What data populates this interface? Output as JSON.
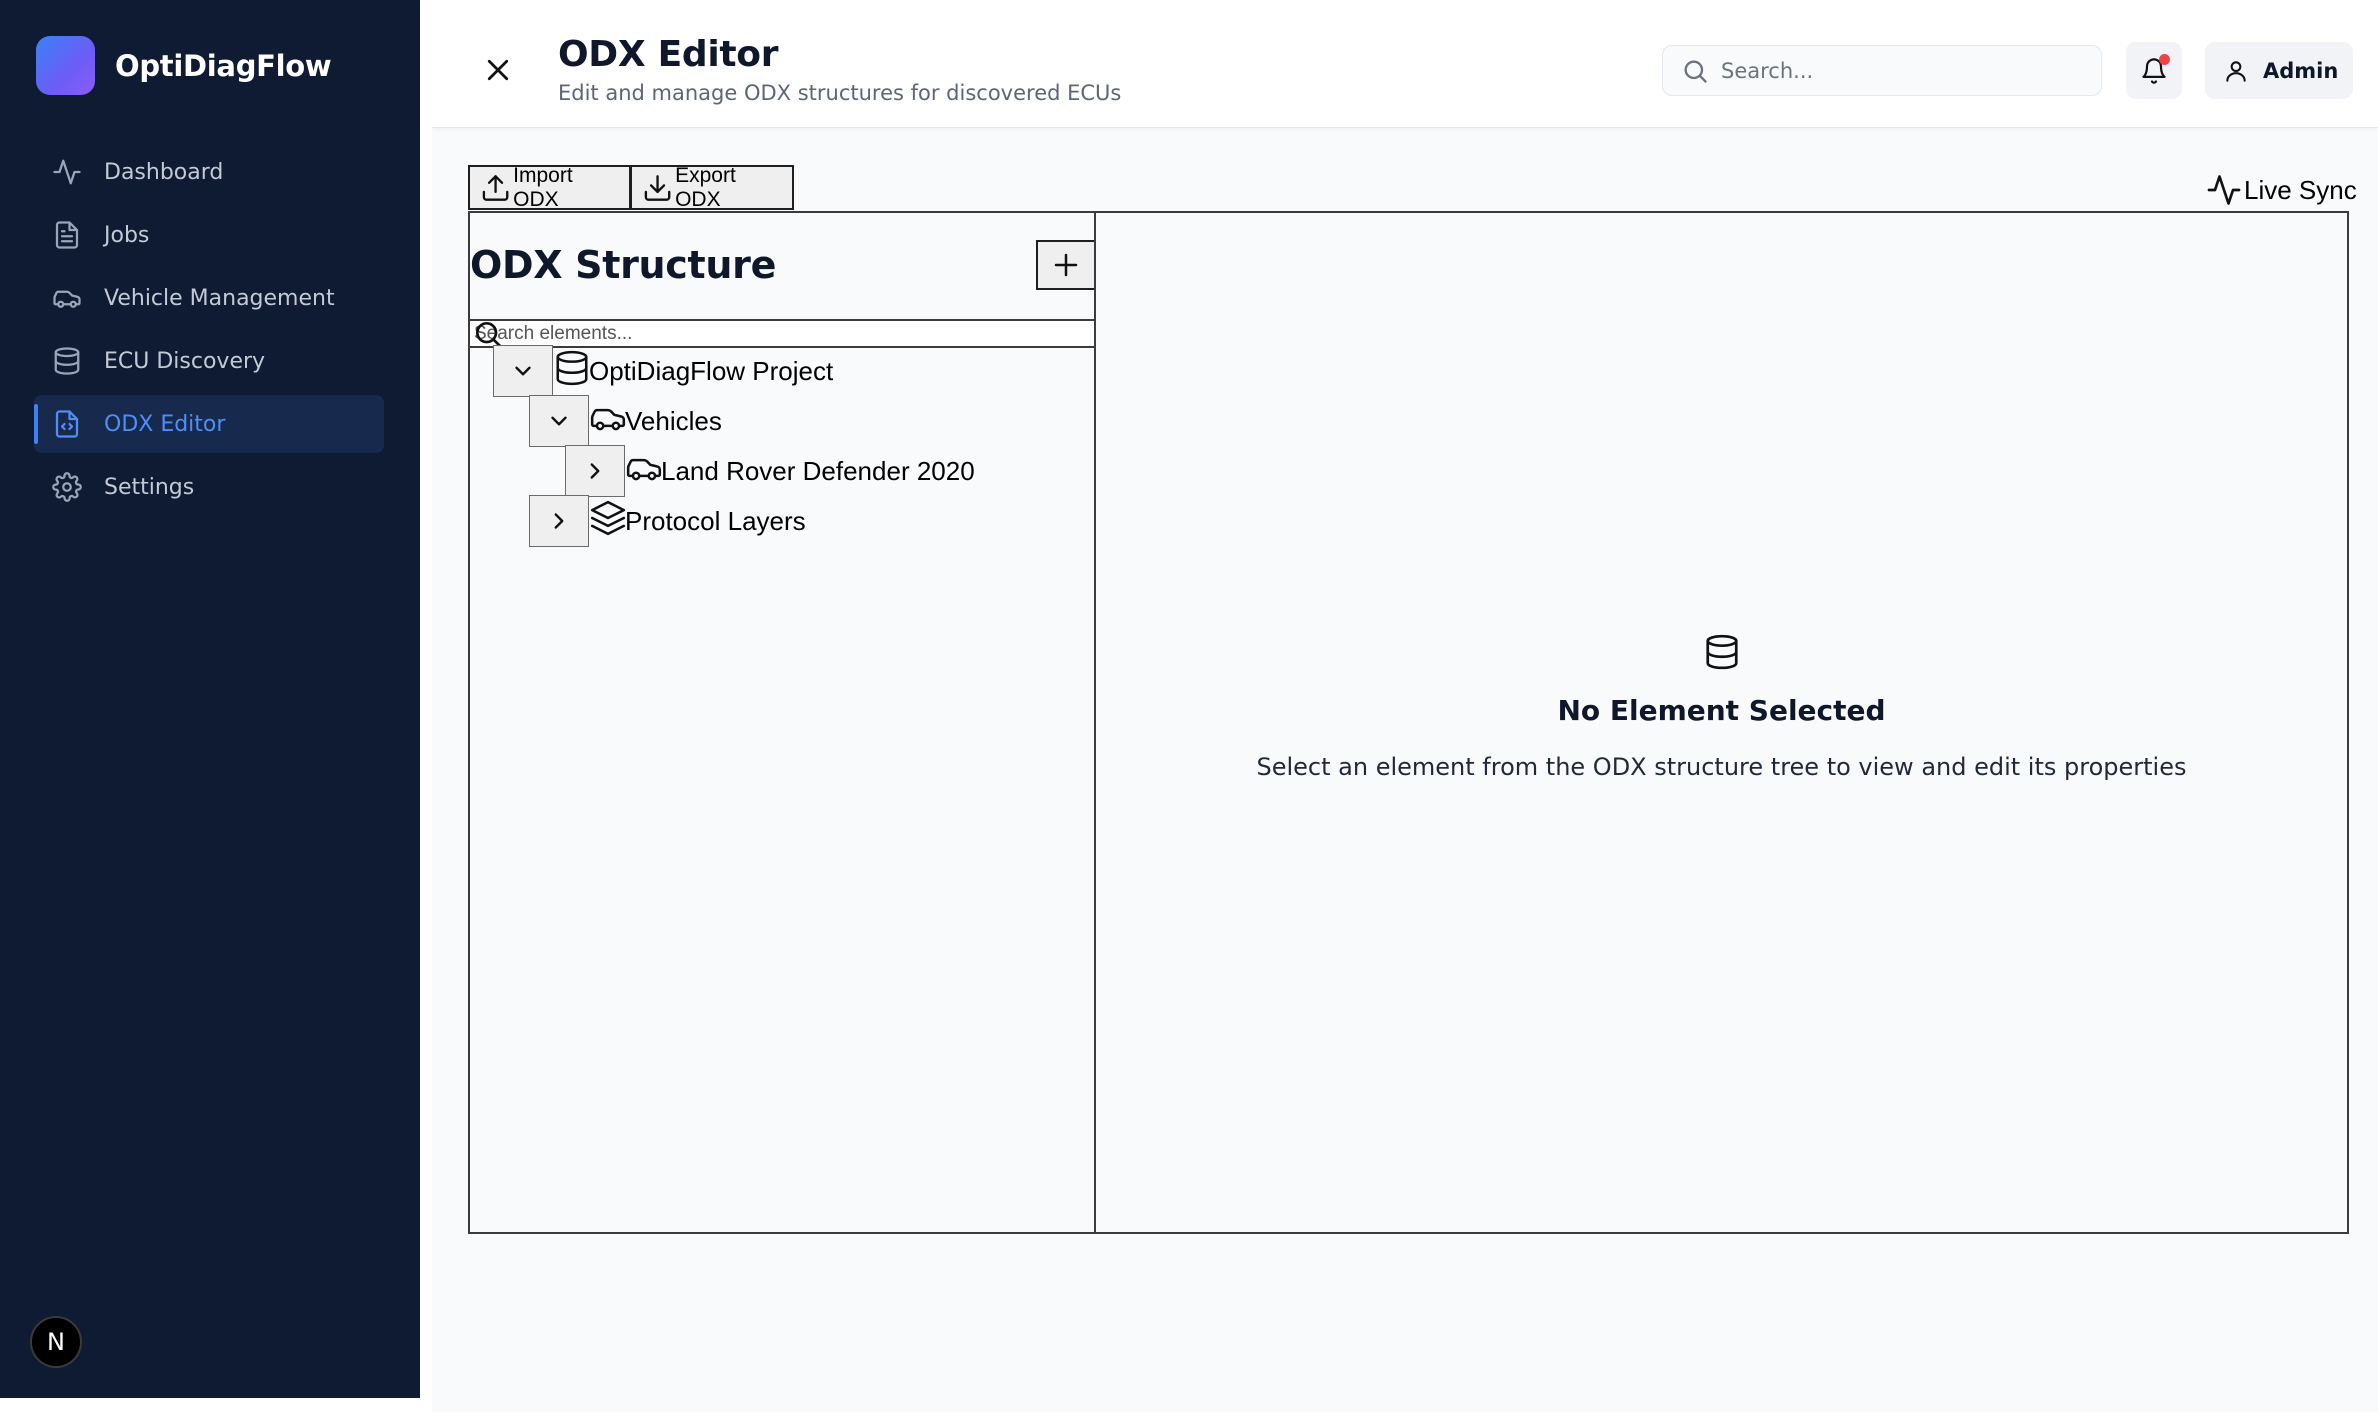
{
  "app": {
    "name": "OptiDiagFlow"
  },
  "sidebar": {
    "items": [
      {
        "label": "Dashboard",
        "icon": "activity-icon",
        "active": false
      },
      {
        "label": "Jobs",
        "icon": "file-text-icon",
        "active": false
      },
      {
        "label": "Vehicle Management",
        "icon": "car-icon",
        "active": false
      },
      {
        "label": "ECU Discovery",
        "icon": "database-icon",
        "active": false
      },
      {
        "label": "ODX Editor",
        "icon": "file-code-icon",
        "active": true
      },
      {
        "label": "Settings",
        "icon": "gear-icon",
        "active": false
      }
    ],
    "footer_badge": "N"
  },
  "header": {
    "title": "ODX Editor",
    "subtitle": "Edit and manage ODX structures for discovered ECUs",
    "search_placeholder": "Search...",
    "user_label": "Admin",
    "notification_dot": true
  },
  "toolbar": {
    "import_label": "Import ODX",
    "export_label": "Export ODX",
    "live_sync_label": "Live Sync"
  },
  "structure": {
    "title": "ODX Structure",
    "search_placeholder": "Search elements...",
    "tree": [
      {
        "label": "OptiDiagFlow Project",
        "icon": "database-icon",
        "expanded": true,
        "level": 0
      },
      {
        "label": "Vehicles",
        "icon": "car-icon",
        "expanded": true,
        "level": 1
      },
      {
        "label": "Land Rover Defender 2020",
        "icon": "car-icon",
        "expanded": false,
        "level": 2
      },
      {
        "label": "Protocol Layers",
        "icon": "layers-icon",
        "expanded": false,
        "level": 1
      }
    ]
  },
  "details": {
    "empty_title": "No Element Selected",
    "empty_description": "Select an element from the ODX structure tree to view and edit its properties"
  },
  "colors": {
    "sidebar_bg": "#0f1b33",
    "accent": "#3b82f6",
    "notification": "#ef4444"
  }
}
